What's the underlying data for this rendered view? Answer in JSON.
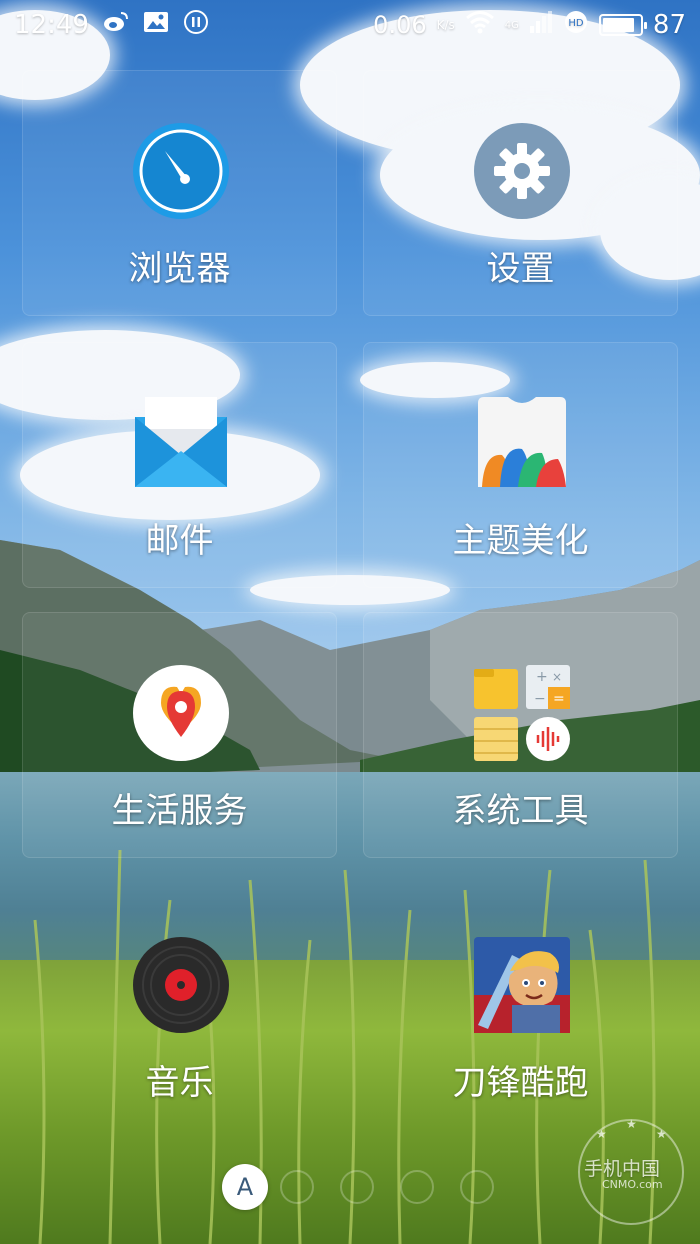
{
  "status_bar": {
    "time": "12:49",
    "net_speed": "0.06",
    "net_unit": "K/s",
    "network": "4G",
    "battery": "87",
    "battery_level": 0.87
  },
  "apps": [
    {
      "label": "浏览器",
      "icon": "browser-icon"
    },
    {
      "label": "设置",
      "icon": "settings-gear-icon"
    },
    {
      "label": "邮件",
      "icon": "mail-icon"
    },
    {
      "label": "主题美化",
      "icon": "theme-icon"
    },
    {
      "label": "生活服务",
      "icon": "location-pin-icon"
    },
    {
      "label": "系统工具",
      "icon": "tools-folder-icon"
    },
    {
      "label": "音乐",
      "icon": "music-disc-icon"
    },
    {
      "label": "刀锋酷跑",
      "icon": "game-icon"
    }
  ],
  "dock": {
    "page_letter": "A"
  },
  "watermark": {
    "text": "手机中国",
    "sub": "CNMO.com"
  },
  "colors": {
    "browser_blue": "#1e9be6",
    "mail_blue": "#2aa6ea",
    "location_red": "#e53935",
    "music_red": "#e0202a"
  }
}
